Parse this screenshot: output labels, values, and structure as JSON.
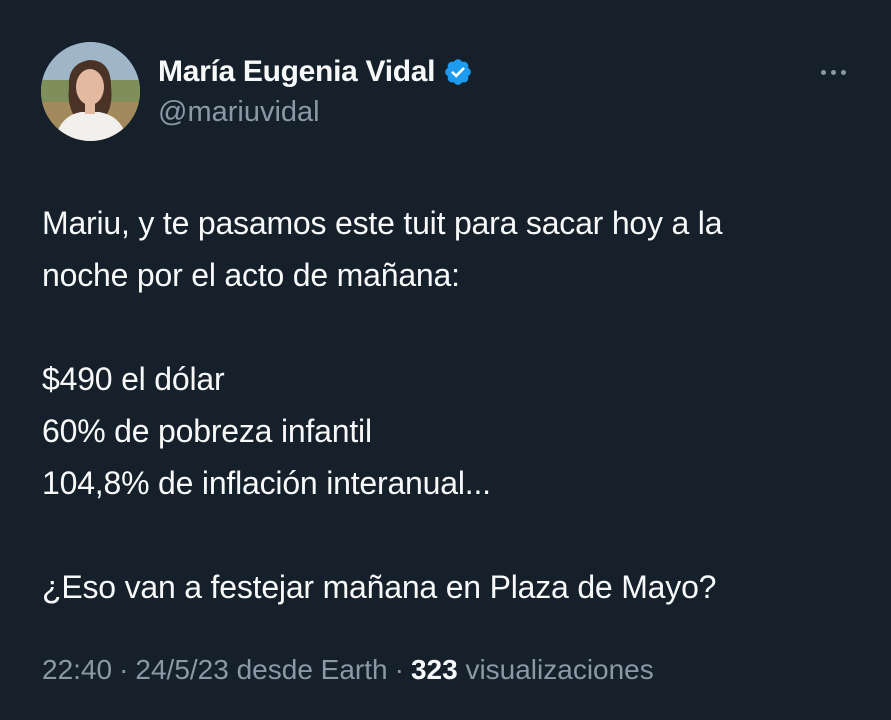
{
  "author": {
    "name": "María Eugenia Vidal",
    "handle": "@mariuvidal",
    "verified": true
  },
  "tweet": {
    "lines": [
      "Mariu, y te pasamos este tuit para sacar hoy a la",
      "noche por el acto de mañana:",
      "$490 el dólar",
      "60% de pobreza infantil",
      "104,8% de inflación interanual...",
      "¿Eso van a festejar mañana en Plaza de Mayo?"
    ]
  },
  "meta": {
    "time": "22:40",
    "separator": "·",
    "date": "24/5/23",
    "source": "desde Earth",
    "views_count": "323",
    "views_label": "visualizaciones"
  },
  "icons": {
    "verified": "verified-badge-icon",
    "more": "more-horizontal-icon"
  },
  "colors": {
    "background": "#15202b",
    "text": "#f7f9f9",
    "secondary": "#8b98a5",
    "verified": "#1d9bf0"
  }
}
